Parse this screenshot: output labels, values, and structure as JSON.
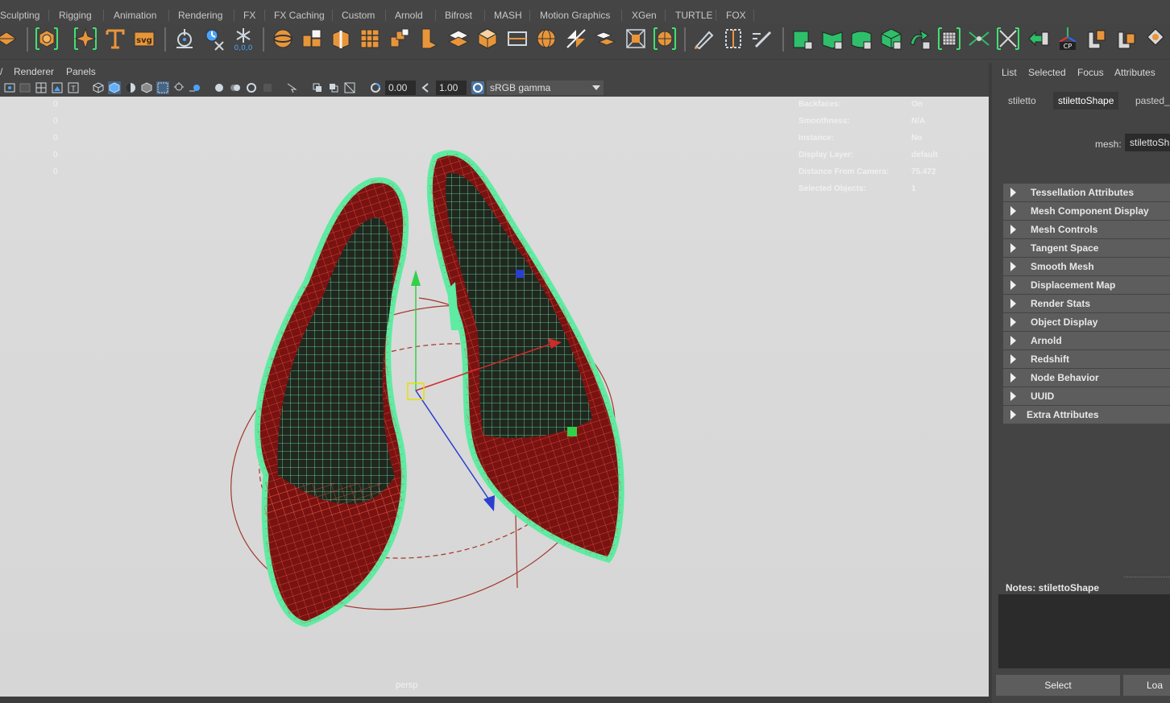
{
  "shelf_tabs": [
    "Sculpting",
    "Rigging",
    "Animation",
    "Rendering",
    "FX",
    "FX Caching",
    "Custom",
    "Arnold",
    "Bifrost",
    "MASH",
    "Motion Graphics",
    "XGen",
    "TURTLE",
    "FOX"
  ],
  "shelf_icons": [
    "poly-wedge-icon",
    "poly-sphere-bracketed-icon",
    "sparkle-bracketed-icon",
    "text-tool-icon",
    "svg-tool-icon",
    "sculpt-tool-icon",
    "transform-clear-icon",
    "snowflake-icon",
    "bevel-ring-icon",
    "bridge-icon",
    "extrude-icon",
    "multi-cut-icon",
    "combine-icon",
    "separate-icon",
    "smooth-mesh-icon",
    "cube-icon",
    "insert-edge-loop-icon",
    "poly-sphere-icon",
    "mirror-icon",
    "merge-icon",
    "triangulate-icon",
    "sphere-bracketed-icon",
    "pencil-icon",
    "crease-tool-icon",
    "brush-icon",
    "assign-material-icon",
    "uv-planar-icon",
    "uv-cylinder-icon",
    "uv-sphere-icon",
    "uv-auto-icon",
    "uv-editor-bracketed-icon",
    "uv-snapshot-icon",
    "edge-cut-bracketed-icon",
    "unfold-icon",
    "cp-pivot-icon",
    "rigid-bind-icon",
    "smooth-bind-icon",
    "paint-weights-icon"
  ],
  "shelf_numbers": "0,0,0",
  "viewport": {
    "menu": [
      "Renderer",
      "Panels"
    ],
    "exposure": "0.00",
    "gamma": "1.00",
    "color_management": "sRGB gamma",
    "camera_label": "persp",
    "hud_left": [
      {
        "label": "",
        "value": "0"
      },
      {
        "label": "",
        "value": "0"
      },
      {
        "label": "",
        "value": "0"
      },
      {
        "label": "",
        "value": "0"
      },
      {
        "label": "",
        "value": "0"
      }
    ],
    "hud_right": [
      {
        "label": "Backfaces:",
        "value": "On"
      },
      {
        "label": "Smoothness:",
        "value": "N/A"
      },
      {
        "label": "Instance:",
        "value": "No"
      },
      {
        "label": "Display Layer:",
        "value": "default"
      },
      {
        "label": "Distance From Camera:",
        "value": "75.472"
      },
      {
        "label": "Selected Objects:",
        "value": "1"
      }
    ],
    "mesh_colors": {
      "wire": "#5eeba2",
      "wire_dark": "#1b2a1f",
      "face": "#7a1212"
    }
  },
  "attribute_editor": {
    "menu": [
      "List",
      "Selected",
      "Focus",
      "Attributes"
    ],
    "tabs": [
      "stiletto",
      "stilettoShape",
      "pasted_"
    ],
    "active_tab": "stilettoShape",
    "mesh_label": "mesh:",
    "mesh_value": "stilettoSh",
    "sections": [
      "Tessellation Attributes",
      "Mesh Component Display",
      "Mesh Controls",
      "Tangent Space",
      "Smooth Mesh",
      "Displacement Map",
      "Render Stats",
      "Object Display",
      "Arnold",
      "Redshift",
      "Node Behavior",
      "UUID",
      "Extra Attributes"
    ],
    "notes_label": "Notes:  stilettoShape",
    "buttons": [
      "Select",
      "Loa"
    ]
  }
}
